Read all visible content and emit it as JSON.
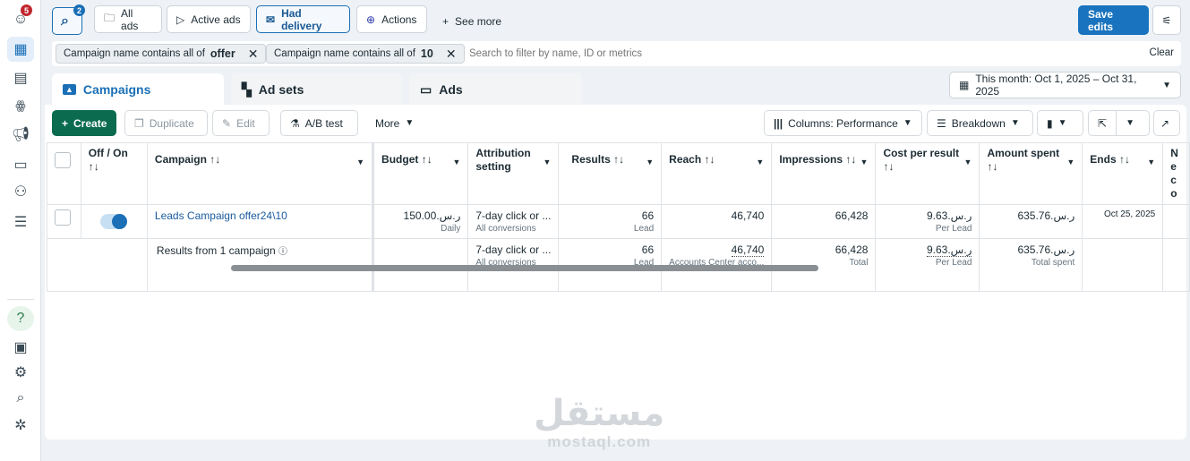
{
  "sidebar": {
    "notification_count": "5",
    "items": [
      "profile",
      "campaigns-table",
      "pages",
      "audiences",
      "ads",
      "billing",
      "accounts",
      "menu",
      "help",
      "news",
      "settings",
      "search",
      "bug-report"
    ]
  },
  "quickfilters": {
    "search_count": "2",
    "all_ads": "All ads",
    "active_ads": "Active ads",
    "had_delivery": "Had delivery",
    "actions": "Actions",
    "see_more": "See more"
  },
  "save_edits": "Save edits",
  "filters": {
    "chips": [
      {
        "label": "Campaign name contains all of",
        "value": "offer"
      },
      {
        "label": "Campaign name contains all of",
        "value": "10"
      }
    ],
    "search_placeholder": "Search to filter by name, ID or metrics",
    "clear": "Clear"
  },
  "tabs": [
    {
      "label": "Campaigns"
    },
    {
      "label": "Ad sets"
    },
    {
      "label": "Ads"
    }
  ],
  "date_range": "This month: Oct 1, 2025 – Oct 31, 2025",
  "toolbar": {
    "create": "Create",
    "duplicate": "Duplicate",
    "edit": "Edit",
    "ab_test": "A/B test",
    "more": "More",
    "columns": "Columns: Performance",
    "breakdown": "Breakdown"
  },
  "table": {
    "headers": {
      "toggle": "Off / On",
      "campaign": "Campaign",
      "budget": "Budget",
      "attribution": "Attribution setting",
      "results": "Results",
      "reach": "Reach",
      "impressions": "Impressions",
      "cost": "Cost per result",
      "amount": "Amount spent",
      "ends": "Ends",
      "next": "Ne co"
    },
    "sort_glyph": "↑↓",
    "row": {
      "toggle_on": true,
      "campaign": "Leads Campaign offer24\\10",
      "budget": "ر.س.150.00",
      "budget_sub": "Daily",
      "attribution": "7-day click or ...",
      "attribution_sub": "All conversions",
      "results": "66",
      "results_sub": "Lead",
      "reach": "46,740",
      "impressions": "66,428",
      "cost": "ر.س.9.63",
      "cost_sub": "Per Lead",
      "amount": "ر.س.635.76",
      "ends": "Oct 25, 2025"
    },
    "summary": {
      "label": "Results from 1 campaign",
      "attribution": "7-day click or ...",
      "attribution_sub": "All conversions",
      "results": "66",
      "results_sub": "Lead",
      "reach": "46,740",
      "reach_sub": "Accounts Center acco...",
      "impressions": "66,428",
      "impressions_sub": "Total",
      "cost": "ر.س.9.63",
      "cost_sub": "Per Lead",
      "amount": "ر.س.635.76",
      "amount_sub": "Total spent"
    }
  },
  "watermark": {
    "arabic": "مستقل",
    "latin": "mostaql.com"
  },
  "colors": {
    "primary": "#1a6fb6",
    "create": "#0b6b4f",
    "notification": "#c0262d"
  }
}
